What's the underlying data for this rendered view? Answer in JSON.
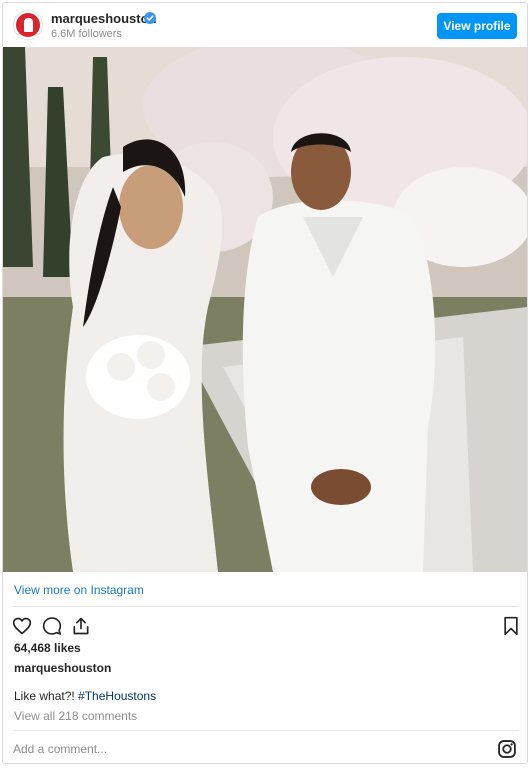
{
  "header": {
    "username": "marqueshouston",
    "followers": "6.6M followers",
    "view_profile_label": "View profile",
    "verified_icon": "verified-badge-icon",
    "accent_color": "#0095f6"
  },
  "post": {
    "photo_alt": "wedding-photo",
    "view_more_label": "View more on Instagram",
    "likes": "64,468 likes",
    "caption_user": "marqueshouston",
    "caption_text": "Like what?! ",
    "caption_hashtag": "#TheHoustons",
    "comments_link": "View all 218 comments"
  },
  "actions": {
    "like_icon": "heart-icon",
    "comment_icon": "comment-icon",
    "share_icon": "share-icon",
    "save_icon": "bookmark-icon"
  },
  "comment_box": {
    "placeholder": "Add a comment...",
    "instagram_icon": "instagram-icon"
  }
}
